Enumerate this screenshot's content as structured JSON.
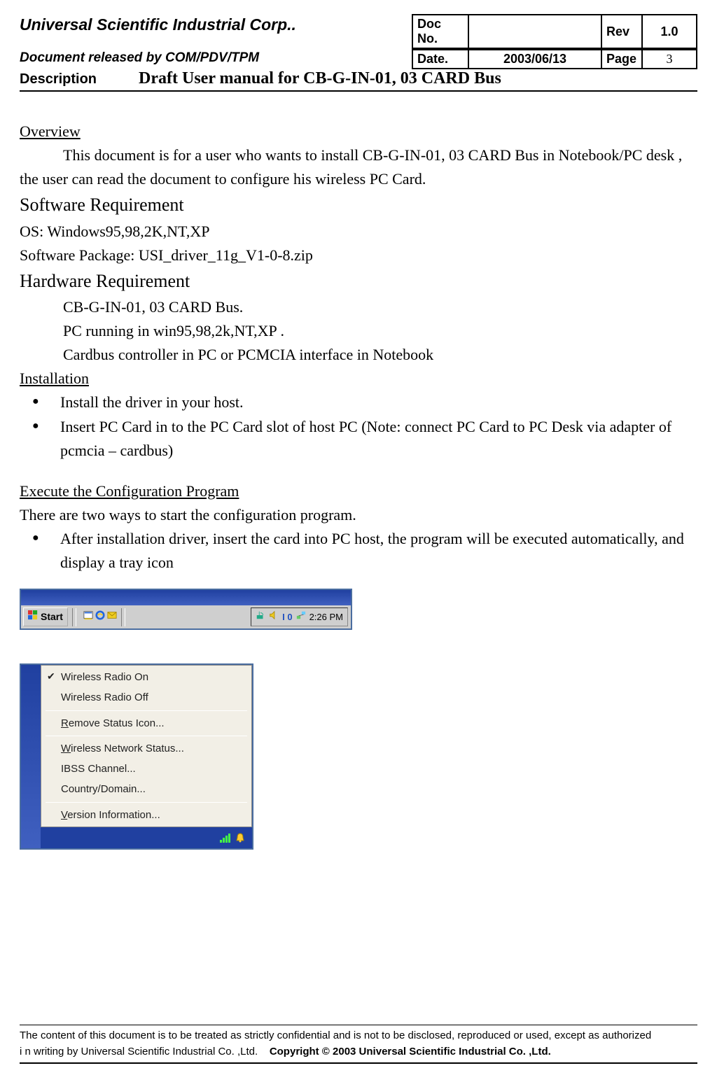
{
  "header": {
    "company": "Universal Scientific Industrial Corp..",
    "released_by": "Document released by  COM/PDV/TPM",
    "docno_label": "Doc No.",
    "docno_value": "",
    "rev_label": "Rev",
    "rev_value": "1.0",
    "date_label": "Date.",
    "date_value": "2003/06/13",
    "page_label": "Page",
    "page_value": "3",
    "desc_label": "Description",
    "desc_title": "Draft User manual for CB-G-IN-01, 03 CARD Bus"
  },
  "body": {
    "overview_h": "Overview",
    "overview_p": "This document is for a user who wants to install CB-G-IN-01, 03 CARD Bus in Notebook/PC desk , the user can read the document to configure his wireless PC Card.",
    "sw_req_h": "Software Requirement",
    "sw_os": "OS: Windows95,98,2K,NT,XP",
    "sw_pkg": "Software Package: USI_driver_11g_V1-0-8.zip",
    "hw_req_h": "Hardware Requirement",
    "hw1": "CB-G-IN-01, 03 CARD Bus.",
    "hw2": "PC running in win95,98,2k,NT,XP .",
    "hw3": "Cardbus controller in PC or PCMCIA interface in Notebook",
    "install_h": "Installation",
    "install_b1": "Install the driver in your host.",
    "install_b2": "Insert PC Card in to the PC Card slot of host PC (Note: connect PC Card to PC Desk via adapter of pcmcia – cardbus)",
    "exec_h": "Execute the Configuration Program",
    "exec_intro": "There are two ways to start the configuration program.",
    "exec_b1": "After installation driver, insert the card into PC host, the program will be executed automatically, and display a tray icon"
  },
  "taskbar": {
    "start_label": "Start",
    "tray_text": "I 0",
    "clock": "2:26 PM"
  },
  "menu": {
    "radio_on": "Wireless Radio On",
    "radio_off": "Wireless Radio Off",
    "remove_pre": "R",
    "remove_rest": "emove Status Icon...",
    "wns_pre": "W",
    "wns_rest": "ireless Network Status...",
    "ibss": "IBSS Channel...",
    "country": "Country/Domain...",
    "ver_pre": "V",
    "ver_rest": "ersion Information..."
  },
  "footer": {
    "line1": "The content of this document is to be treated as strictly confidential and is not to be disclosed, reproduced or used, except as authorized",
    "line2a": "i n writing by Universal Scientific Industrial Co. ,Ltd.",
    "copyright": "Copyright © 2003 Universal Scientific Industrial Co. ,Ltd."
  }
}
